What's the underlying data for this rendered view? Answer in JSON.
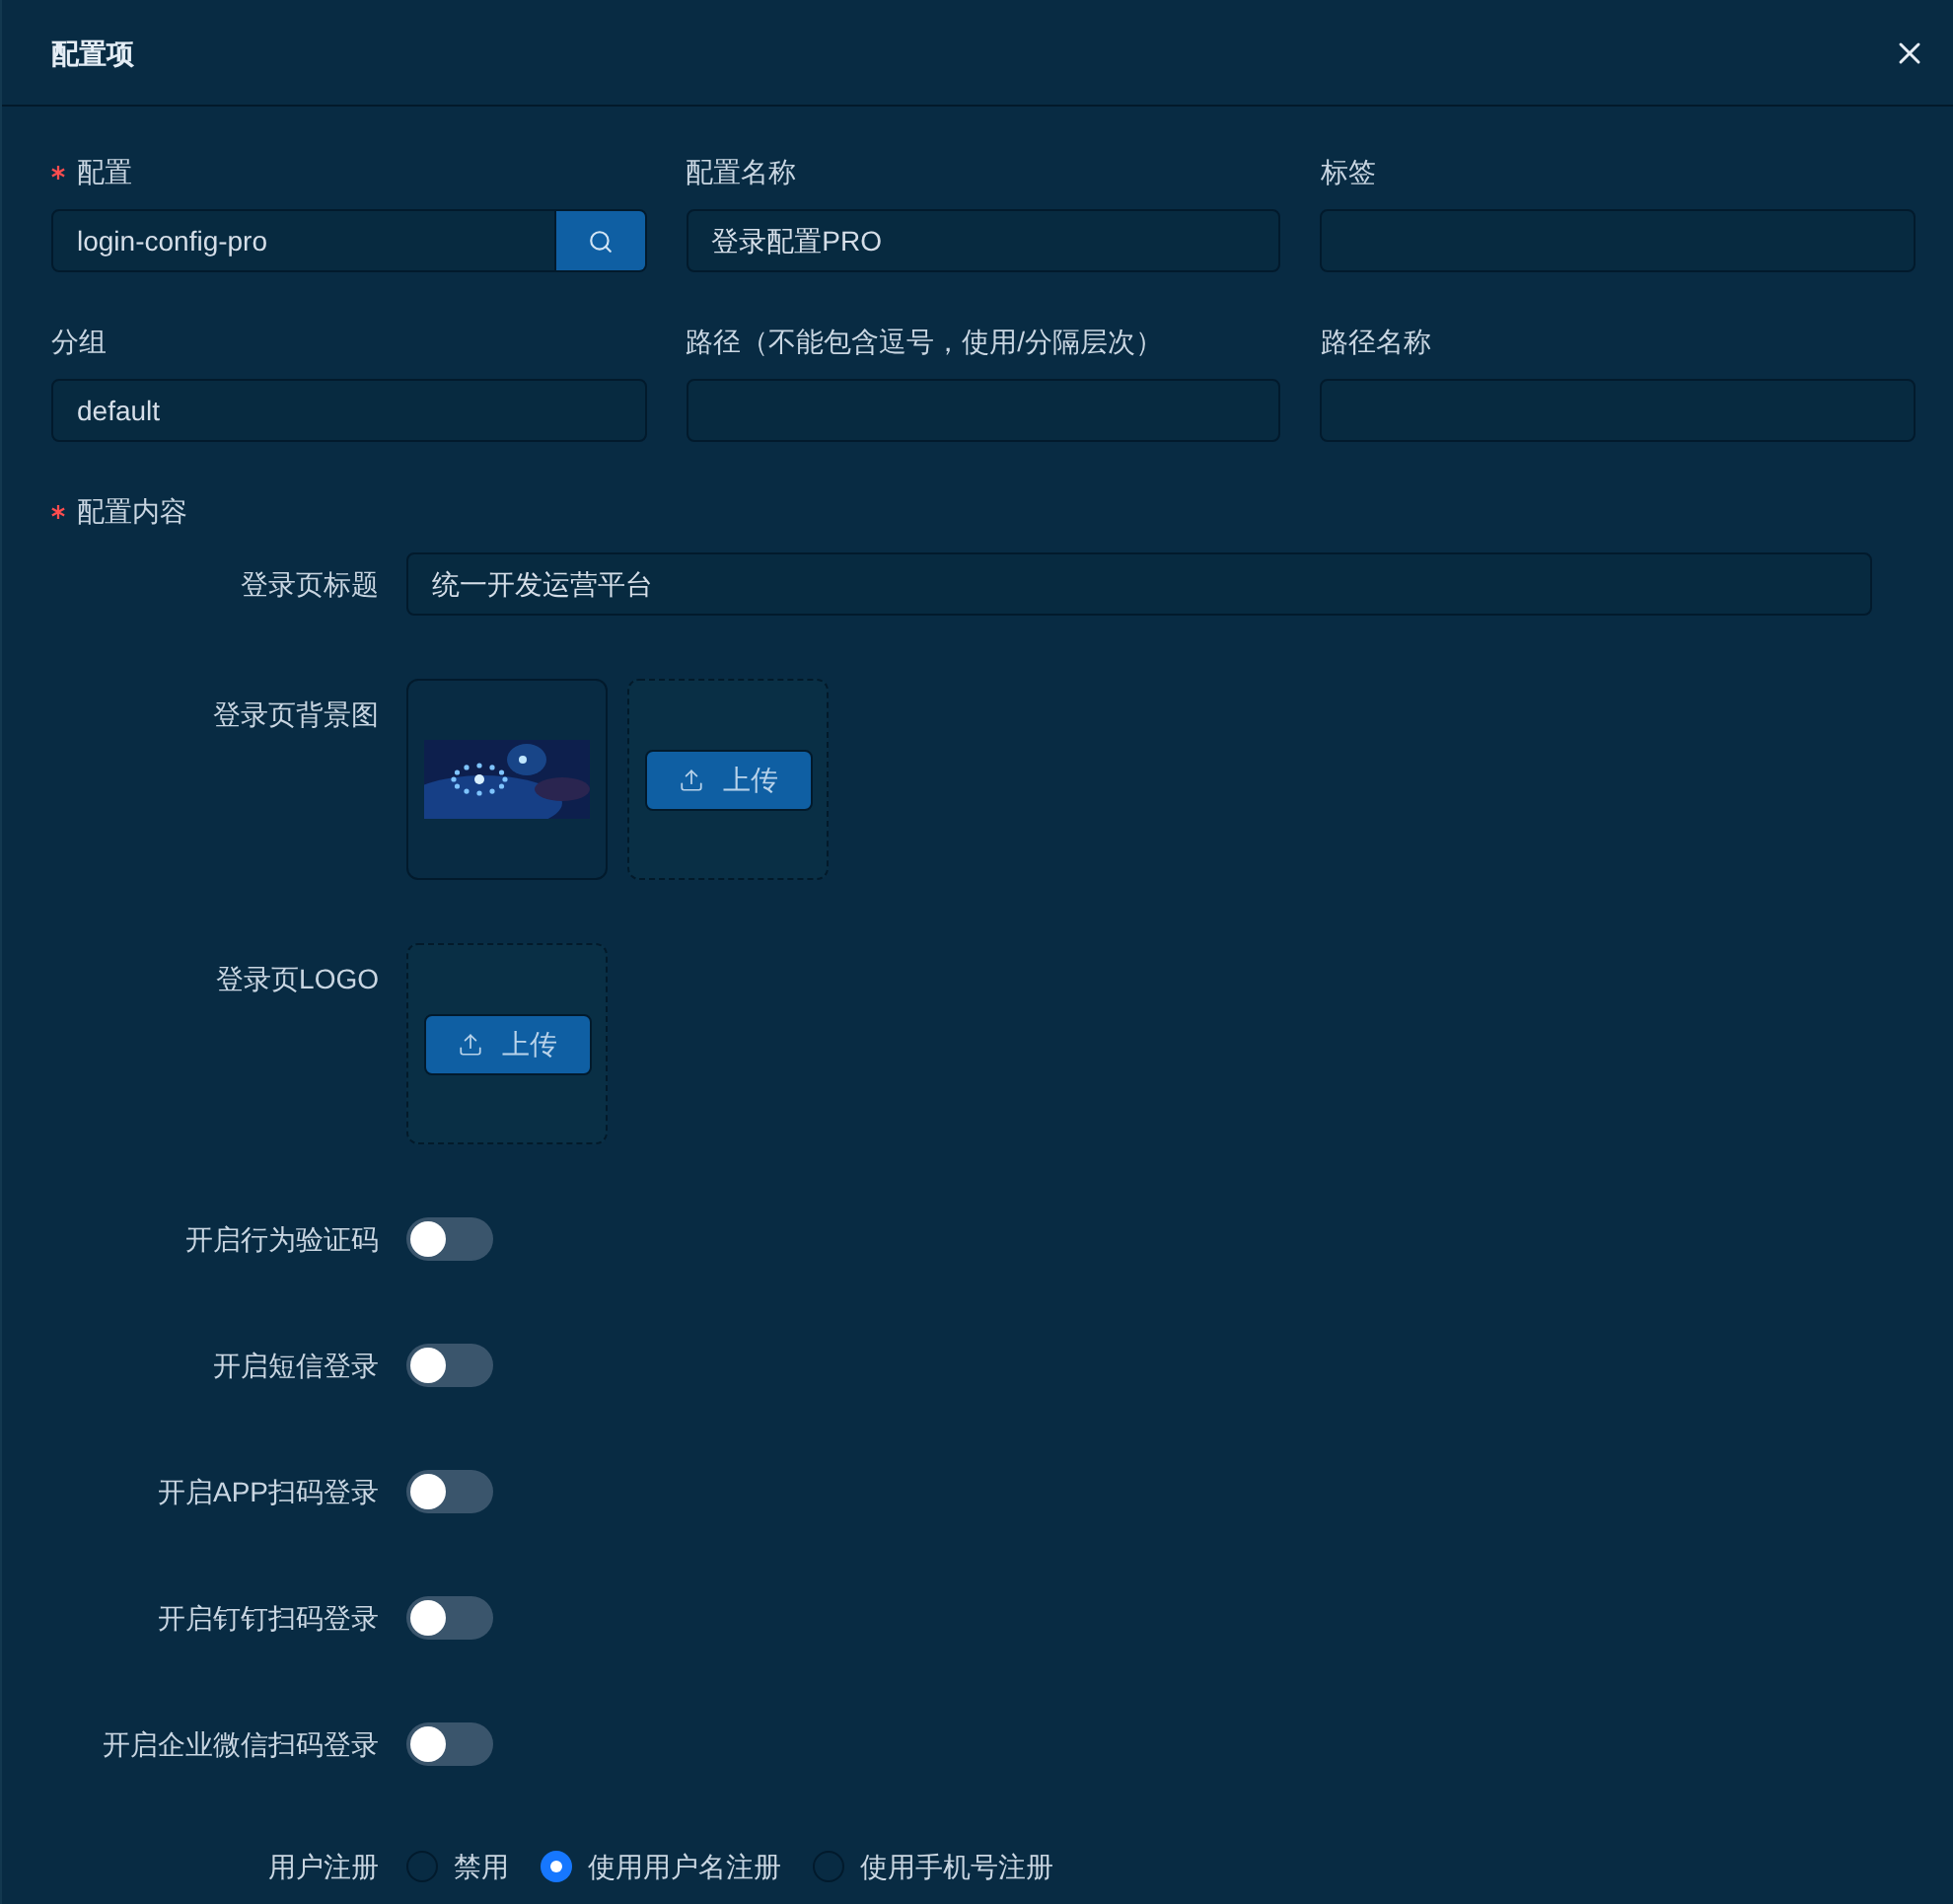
{
  "dialog": {
    "title": "配置项"
  },
  "fields": [
    {
      "label": "配置",
      "required": true,
      "value": "login-config-pro",
      "kind": "search"
    },
    {
      "label": "配置名称",
      "required": false,
      "value": "登录配置PRO",
      "kind": "text"
    },
    {
      "label": "标签",
      "required": false,
      "kind": "text"
    },
    {
      "label": "分组",
      "required": false,
      "value": "default",
      "kind": "text"
    },
    {
      "label": "路径（不能包含逗号，使用/分隔层次）",
      "required": false,
      "kind": "text"
    },
    {
      "label": "路径名称",
      "required": false,
      "kind": "text"
    }
  ],
  "content": {
    "label": "配置内容",
    "required": true,
    "items": [
      {
        "kind": "text",
        "label": "登录页标题",
        "value": "统一开发运营平台"
      },
      {
        "kind": "upload",
        "label": "登录页背景图",
        "button": "上传"
      },
      {
        "kind": "upload",
        "label": "登录页LOGO",
        "button": "上传"
      },
      {
        "kind": "switch",
        "label": "开启行为验证码",
        "on": false
      },
      {
        "kind": "switch",
        "label": "开启短信登录",
        "on": false
      },
      {
        "kind": "switch",
        "label": "开启APP扫码登录",
        "on": false
      },
      {
        "kind": "switch",
        "label": "开启钉钉扫码登录",
        "on": false
      },
      {
        "kind": "switch",
        "label": "开启企业微信扫码登录",
        "on": false
      },
      {
        "kind": "radio",
        "label": "用户注册",
        "options": [
          {
            "label": "禁用",
            "selected": false
          },
          {
            "label": "使用用户名注册",
            "selected": true
          },
          {
            "label": "使用手机号注册",
            "selected": false
          }
        ]
      }
    ]
  }
}
